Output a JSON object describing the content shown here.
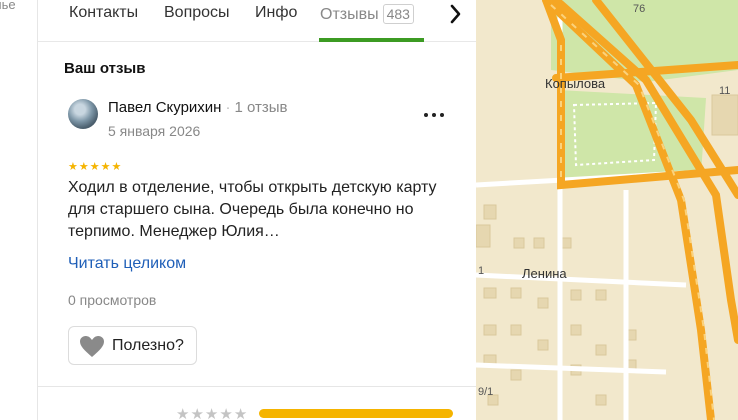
{
  "left_strip": {
    "cut_text": "лье"
  },
  "tabs": {
    "items": [
      {
        "label": "Контакты"
      },
      {
        "label": "Вопросы"
      },
      {
        "label": "Инфо"
      },
      {
        "label": "Отзывы",
        "count": "483"
      }
    ],
    "active_index": 3,
    "next_icon": "chevron-right-icon"
  },
  "review": {
    "section_title": "Ваш отзыв",
    "author": "Павел Скурихин",
    "author_reviews": "1 отзыв",
    "date": "5 января 2026",
    "rating": 5,
    "max_rating": 5,
    "text": "Ходил в отделение, чтобы открыть детскую карту для старшего сына. Очередь была конечно но терпимо. Менеджер Юлия…",
    "read_more": "Читать целиком",
    "views": "0 просмотров",
    "helpful_label": "Полезно?",
    "helpful_icon": "heart-icon",
    "more_icon": "more-dots-icon"
  },
  "next_rating": {
    "rating": 0,
    "max_rating": 5
  },
  "map": {
    "labels": {
      "kopylova": "Копылова",
      "lenina": "Ленина",
      "n76": "76",
      "n91": "9/1",
      "n1": "1",
      "n11": "11"
    },
    "colors": {
      "road_major": "#f5a623",
      "park": "#cfe6a8",
      "background": "#f2e8cc"
    }
  }
}
